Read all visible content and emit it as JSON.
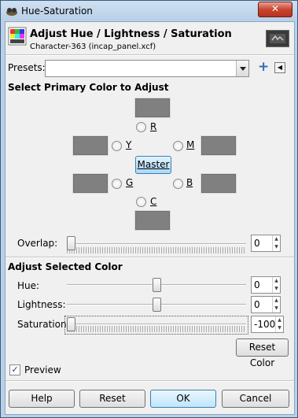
{
  "window": {
    "title": "Hue-Saturation",
    "close_label": "✕"
  },
  "header": {
    "title": "Adjust Hue / Lightness / Saturation",
    "subtitle": "Character-363 (incap_panel.xcf)"
  },
  "presets": {
    "label": "Presets:",
    "value": "",
    "add_label": "+",
    "menu_label": "◀"
  },
  "primary": {
    "heading": "Select Primary Color to Adjust",
    "colors": {
      "r": "R",
      "y": "Y",
      "m": "M",
      "g": "G",
      "b": "B",
      "c": "C"
    },
    "master_label": "Master",
    "swatch_color": "#808080"
  },
  "overlap": {
    "label": "Overlap:",
    "value": "0"
  },
  "adjust": {
    "heading": "Adjust Selected Color",
    "hue": {
      "label": "Hue:",
      "value": "0"
    },
    "lightness": {
      "label": "Lightness:",
      "value": "0"
    },
    "saturation": {
      "label": "Saturation:",
      "value": "-100"
    },
    "reset_label": "Reset Color"
  },
  "preview": {
    "label": "Preview",
    "checked": true,
    "check_glyph": "✓"
  },
  "buttons": {
    "help": "Help",
    "reset": "Reset",
    "ok": "OK",
    "cancel": "Cancel"
  },
  "spin_glyphs": {
    "up": "▲",
    "down": "▼"
  }
}
